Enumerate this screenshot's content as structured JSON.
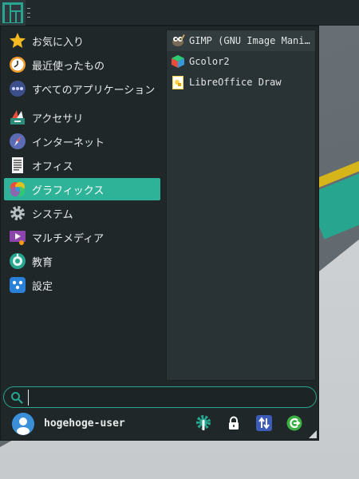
{
  "colors": {
    "accent": "#2eb398",
    "panel": "#22292c",
    "menu_bg": "#1f2729",
    "apps_bg": "#293235",
    "text": "#e6e8e8"
  },
  "categories": [
    {
      "label": "お気に入り",
      "icon": "star-icon"
    },
    {
      "label": "最近使ったもの",
      "icon": "clock-icon"
    },
    {
      "label": "すべてのアプリケーション",
      "icon": "apps-dots-icon"
    },
    {
      "label": "アクセサリ",
      "icon": "accessories-icon"
    },
    {
      "label": "インターネット",
      "icon": "compass-icon"
    },
    {
      "label": "オフィス",
      "icon": "document-icon"
    },
    {
      "label": "グラフィックス",
      "icon": "color-wheel-icon",
      "active": true
    },
    {
      "label": "システム",
      "icon": "gear-icon"
    },
    {
      "label": "マルチメディア",
      "icon": "multimedia-icon"
    },
    {
      "label": "教育",
      "icon": "education-icon"
    },
    {
      "label": "設定",
      "icon": "settings-icon"
    }
  ],
  "apps": [
    {
      "label": "GIMP (GNU Image Mani…",
      "icon": "gimp-icon"
    },
    {
      "label": "Gcolor2",
      "icon": "gcolor-icon"
    },
    {
      "label": "LibreOffice Draw",
      "icon": "libreoffice-draw-icon"
    }
  ],
  "search": {
    "value": "",
    "placeholder": ""
  },
  "user": {
    "name": "hogehoge-user"
  },
  "actions": [
    {
      "name": "settings-manager-icon"
    },
    {
      "name": "lock-icon"
    },
    {
      "name": "switch-user-icon"
    },
    {
      "name": "logout-icon"
    }
  ]
}
